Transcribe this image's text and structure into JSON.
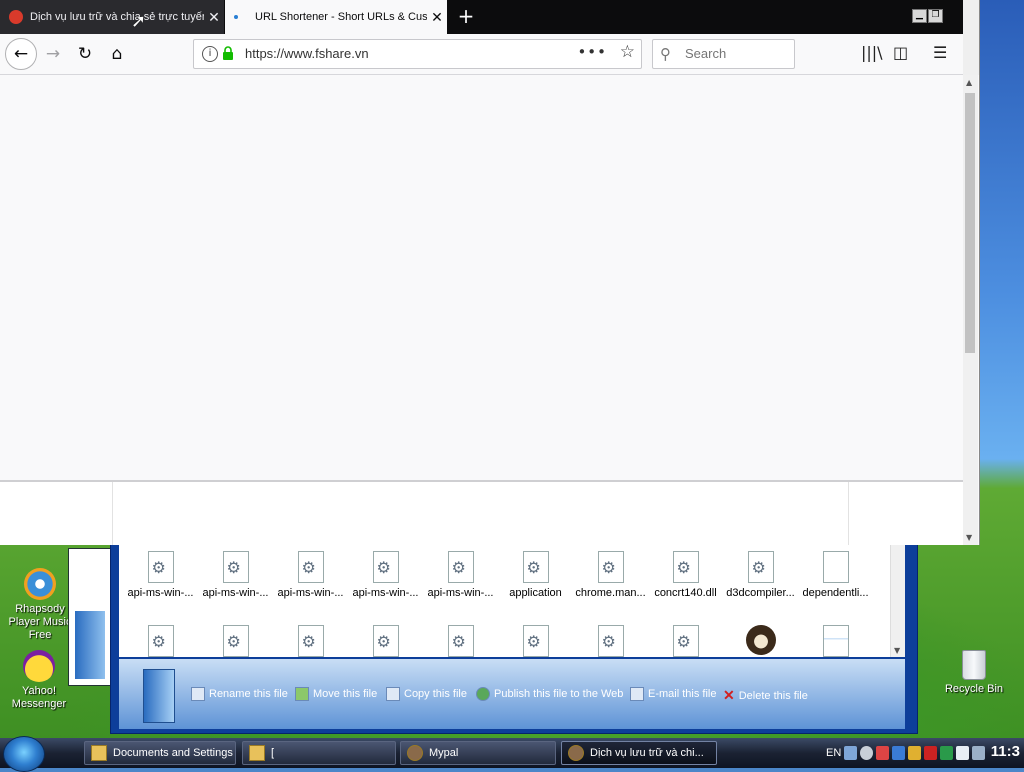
{
  "browser": {
    "tabs": [
      {
        "title": "Dịch vụ lưu trữ và chia sẻ trực tuyến",
        "favicon_color": "#d93a2b",
        "active": true
      },
      {
        "title": "URL Shortener - Short URLs & Custom",
        "favicon_color": "#2a7fd4",
        "active": false
      }
    ],
    "new_tab_label": "+",
    "url": "https://www.fshare.vn",
    "search_placeholder": "Search"
  },
  "explorer": {
    "files_row1": [
      "api-ms-win-...",
      "api-ms-win-...",
      "api-ms-win-...",
      "api-ms-win-...",
      "api-ms-win-...",
      "application",
      "chrome.man...",
      "concrt140.dll",
      "d3dcompiler...",
      "dependentli..."
    ],
    "tasks": [
      {
        "label": "Rename this file",
        "icon": "rename-icon"
      },
      {
        "label": "Move this file",
        "icon": "move-icon"
      },
      {
        "label": "Copy this file",
        "icon": "copy-icon"
      },
      {
        "label": "Publish this file to the Web",
        "icon": "globe-icon"
      },
      {
        "label": "E-mail this file",
        "icon": "email-icon"
      },
      {
        "label": "Delete this file",
        "icon": "delete-icon"
      }
    ]
  },
  "desktop": {
    "icons": [
      {
        "label": "Rhapsody Player Music Free",
        "icon": "rhapsody-icon"
      },
      {
        "label": "Yahoo! Messenger",
        "icon": "yahoo-messenger-icon"
      },
      {
        "label": "Recycle Bin",
        "icon": "recycle-bin-icon"
      }
    ]
  },
  "taskbar": {
    "buttons": [
      {
        "label": "Documents and Settings"
      },
      {
        "label": "["
      },
      {
        "label": "Mypal"
      },
      {
        "label": "Dịch vụ lưu trữ và chi..."
      }
    ],
    "language": "EN",
    "clock": "11:3"
  }
}
